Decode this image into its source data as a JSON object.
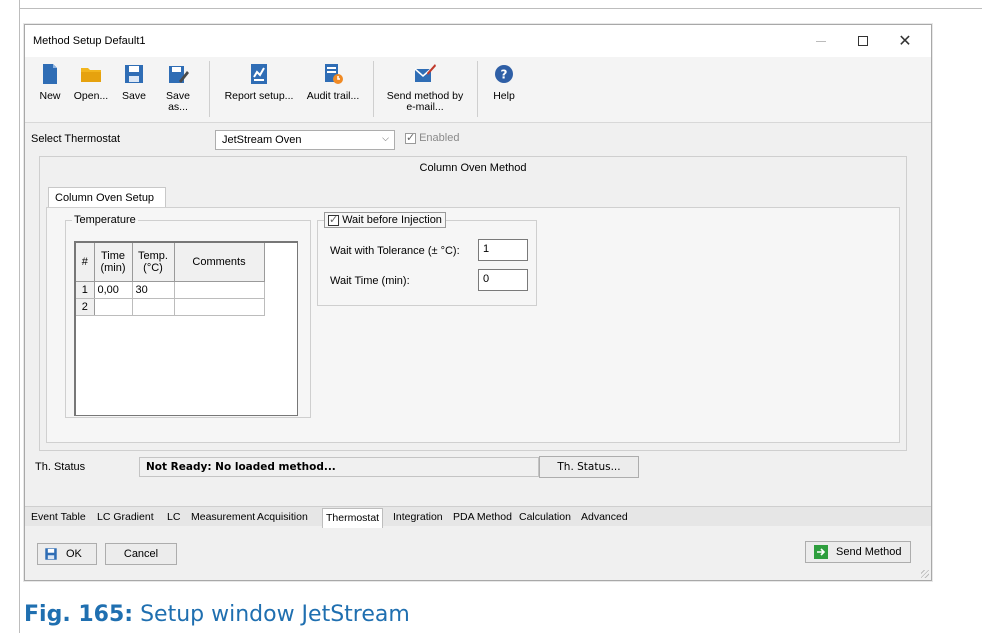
{
  "window": {
    "title": "Method Setup Default1"
  },
  "toolbar": {
    "buttons": [
      {
        "label": "New",
        "icon": "new-document-icon"
      },
      {
        "label": "Open...",
        "icon": "folder-icon"
      },
      {
        "label": "Save",
        "icon": "save-icon"
      },
      {
        "label": "Save as...",
        "icon": "save-as-icon"
      },
      {
        "label": "Report setup...",
        "icon": "report-setup-icon"
      },
      {
        "label": "Audit trail...",
        "icon": "audit-trail-icon"
      },
      {
        "label": "Send method by e-mail...",
        "icon": "email-icon"
      },
      {
        "label": "Help",
        "icon": "help-icon"
      }
    ]
  },
  "thermostat": {
    "label": "Select Thermostat",
    "selected": "JetStream Oven",
    "enabled_label": "Enabled",
    "enabled_checked": true
  },
  "method": {
    "title": "Column Oven Method",
    "tab": "Column Oven Setup",
    "temperature": {
      "caption": "Temperature",
      "headers": [
        "#",
        "Time (min)",
        "Temp. (°C)",
        "Comments"
      ],
      "rows": [
        {
          "num": "1",
          "time": "0,00",
          "temp": "30",
          "comments": ""
        },
        {
          "num": "2",
          "time": "",
          "temp": "",
          "comments": ""
        }
      ]
    },
    "wait": {
      "checkbox_label": "Wait before Injection",
      "checked": true,
      "tolerance_label": "Wait with Tolerance (± °C):",
      "tolerance_value": "1",
      "time_label": "Wait Time (min):",
      "time_value": "0"
    }
  },
  "status": {
    "label": "Th. Status",
    "text": "Not Ready: No loaded method...",
    "button": "Th. Status..."
  },
  "tabs": [
    "Event Table",
    "LC Gradient",
    "LC",
    "Measurement",
    "Acquisition",
    "Thermostat",
    "Integration",
    "PDA Method",
    "Calculation",
    "Advanced"
  ],
  "active_tab": "Thermostat",
  "footer": {
    "ok": "OK",
    "cancel": "Cancel",
    "send": "Send Method"
  },
  "caption": {
    "prefix": "Fig. 165:",
    "text": "Setup window JetStream"
  },
  "colors": {
    "accent_blue": "#1f6fb0",
    "icon_blue": "#2f6db5",
    "folder_yellow": "#f2b51d",
    "send_green": "#2e9e3e"
  }
}
